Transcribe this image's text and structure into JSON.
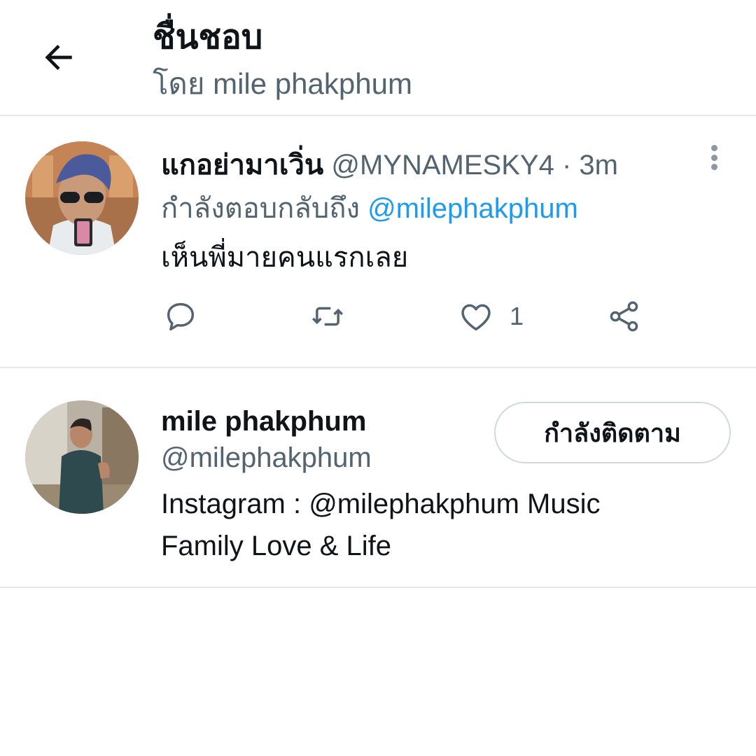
{
  "header": {
    "back_icon": "arrow-left-icon",
    "title": "ชื่นชอบ",
    "subtitle": "โดย mile phakphum"
  },
  "tweet": {
    "author_name": "แกอย่ามาเวิ่น",
    "author_handle": "@MYNAMESKY4",
    "separator": "·",
    "time": "3m",
    "reply_prefix": "กำลังตอบกลับถึง",
    "reply_mention": "@milephakphum",
    "text": "เห็นพี่มายคนแรกเลย",
    "actions": {
      "reply_icon": "reply-icon",
      "retweet_icon": "retweet-icon",
      "like_icon": "heart-icon",
      "like_count": "1",
      "share_icon": "share-icon"
    },
    "more_icon": "more-vertical-icon"
  },
  "profile": {
    "name": "mile phakphum",
    "handle": "@milephakphum",
    "follow_label": "กำลังติดตาม",
    "bio_lines": [
      "Instagram : @milephakphum Music",
      "Family Love & Life"
    ]
  },
  "colors": {
    "text_primary": "#0f1419",
    "text_secondary": "#536471",
    "link": "#1d9bf0",
    "divider": "#e6e9eb",
    "button_border": "#cfd9de"
  }
}
